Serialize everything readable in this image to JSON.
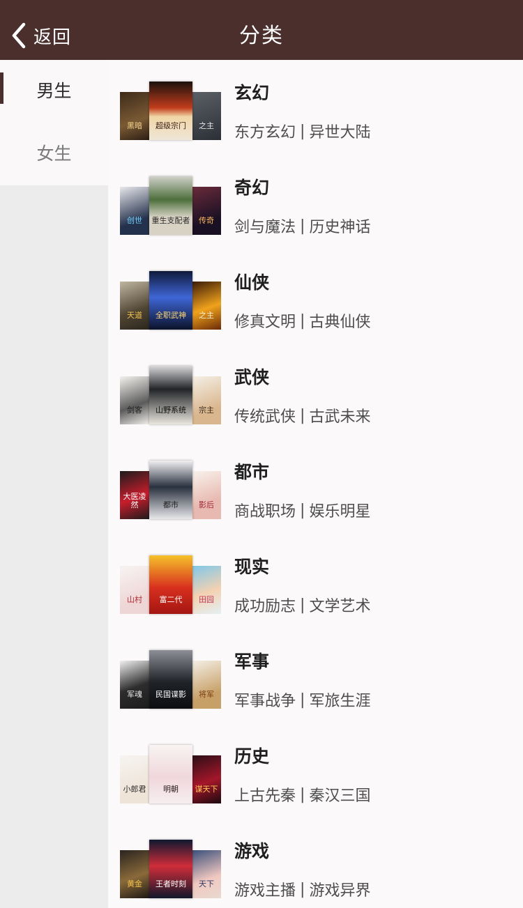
{
  "header": {
    "back_label": "返回",
    "title": "分类"
  },
  "sidebar": {
    "items": [
      {
        "label": "男生",
        "active": true
      },
      {
        "label": "女生",
        "active": false
      }
    ]
  },
  "categories": [
    {
      "name": "玄幻",
      "subs": [
        "东方玄幻",
        "异世大陆"
      ],
      "covers": [
        {
          "bg": "linear-gradient(160deg,#3d2b1a,#7a5a34 60%,#2c1e14)",
          "text": "黑暗",
          "fg": "#f3d38a"
        },
        {
          "bg": "linear-gradient(180deg,#1b120d,#c23c1c 45%,#f0d6a6 60%,#efe6d8)",
          "text": "超级宗门",
          "fg": "#3a1a10"
        },
        {
          "bg": "linear-gradient(160deg,#5b6067,#2c3036)",
          "text": "之主",
          "fg": "#e9e9e9"
        }
      ]
    },
    {
      "name": "奇幻",
      "subs": [
        "剑与魔法",
        "历史神话"
      ],
      "covers": [
        {
          "bg": "linear-gradient(160deg,#e8e8ec,#24314c 70%)",
          "text": "创世",
          "fg": "#6fd0ff"
        },
        {
          "bg": "linear-gradient(180deg,#cfd0c8,#4d6f3c 40%,#d7d2c4 70%)",
          "text": "重生支配者",
          "fg": "#2b2b2b"
        },
        {
          "bg": "linear-gradient(160deg,#6a2b3a,#1a1024 70%)",
          "text": "传奇",
          "fg": "#ffb65a"
        }
      ]
    },
    {
      "name": "仙侠",
      "subs": [
        "修真文明",
        "古典仙侠"
      ],
      "covers": [
        {
          "bg": "linear-gradient(160deg,#bfb6a1,#514634 60%,#2a251d)",
          "text": "天道",
          "fg": "#f2c44b"
        },
        {
          "bg": "linear-gradient(180deg,#0f1a3a,#3f66d6 45%,#0c122a)",
          "text": "全职武神",
          "fg": "#ffd76a"
        },
        {
          "bg": "linear-gradient(160deg,#3a1b06,#f0a21c 55%,#6a2a07)",
          "text": "之主",
          "fg": "#fff3d4"
        }
      ]
    },
    {
      "name": "武侠",
      "subs": [
        "传统武侠",
        "古武未来"
      ],
      "covers": [
        {
          "bg": "linear-gradient(160deg,#f4f2ee,#5b5b5b 60%,#f2f0ec)",
          "text": "剑客",
          "fg": "#1c1c1c"
        },
        {
          "bg": "linear-gradient(180deg,#d8d8da,#222428 40%,#e9e6de)",
          "text": "山野系统",
          "fg": "#101010"
        },
        {
          "bg": "linear-gradient(160deg,#f5efe6,#d9b68d 70%)",
          "text": "宗主",
          "fg": "#3a2a1a"
        }
      ]
    },
    {
      "name": "都市",
      "subs": [
        "商战职场",
        "娱乐明星"
      ],
      "covers": [
        {
          "bg": "linear-gradient(160deg,#1c1c1c,#c81d2c 55%,#1c1c1c)",
          "text": "大医凌然",
          "fg": "#ffffff"
        },
        {
          "bg": "linear-gradient(180deg,#f1f1f3,#29313f 45%,#e8e8ea)",
          "text": "都市",
          "fg": "#222222"
        },
        {
          "bg": "linear-gradient(160deg,#f8f2ec,#e7b9b0 65%)",
          "text": "影后",
          "fg": "#a32a3a"
        }
      ]
    },
    {
      "name": "现实",
      "subs": [
        "成功励志",
        "文学艺术"
      ],
      "covers": [
        {
          "bg": "linear-gradient(160deg,#f7f3f3,#efd6d6 70%)",
          "text": "山村",
          "fg": "#b22a33"
        },
        {
          "bg": "linear-gradient(180deg,#f6c12a,#d8301e 55%,#a41512)",
          "text": "富二代",
          "fg": "#ffffff"
        },
        {
          "bg": "linear-gradient(160deg,#7ec8ea,#f4d1b1 55%,#e3f0f4)",
          "text": "田园",
          "fg": "#c43c5a"
        }
      ]
    },
    {
      "name": "军事",
      "subs": [
        "军事战争",
        "军旅生涯"
      ],
      "covers": [
        {
          "bg": "linear-gradient(160deg,#f0f0f0,#2d2d2d 55%,#1c1c1c)",
          "text": "军魂",
          "fg": "#e8e8e8"
        },
        {
          "bg": "linear-gradient(180deg,#8c9096,#1f2227 55%,#0d0e10)",
          "text": "民国谍影",
          "fg": "#ffffff"
        },
        {
          "bg": "linear-gradient(160deg,#f4efe6,#c7a067 70%)",
          "text": "将军",
          "fg": "#7a3d10"
        }
      ]
    },
    {
      "name": "历史",
      "subs": [
        "上古先秦",
        "秦汉三国"
      ],
      "covers": [
        {
          "bg": "linear-gradient(160deg,#f6f4f1,#efe4d8 70%)",
          "text": "小郎君",
          "fg": "#2a2a2a"
        },
        {
          "bg": "linear-gradient(180deg,#f8f3f2,#f0d7dc 55%,#f6eef0)",
          "text": "明朝",
          "fg": "#2a1a1a"
        },
        {
          "bg": "linear-gradient(160deg,#2a0f16,#a5162a 55%,#1b0a0f)",
          "text": "谋天下",
          "fg": "#ffcc55"
        }
      ]
    },
    {
      "name": "游戏",
      "subs": [
        "游戏主播",
        "游戏异界"
      ],
      "covers": [
        {
          "bg": "linear-gradient(160deg,#2a2420,#8a6a3a 55%,#1e1814)",
          "text": "黄金",
          "fg": "#f3c24a"
        },
        {
          "bg": "linear-gradient(180deg,#0f1830,#d02d3a 45%,#11182a)",
          "text": "王者时刻",
          "fg": "#ffffff"
        },
        {
          "bg": "linear-gradient(160deg,#3a4f7a,#f1c8c0 60%,#e8d9cf)",
          "text": "天下",
          "fg": "#2a3a6a"
        }
      ]
    }
  ]
}
